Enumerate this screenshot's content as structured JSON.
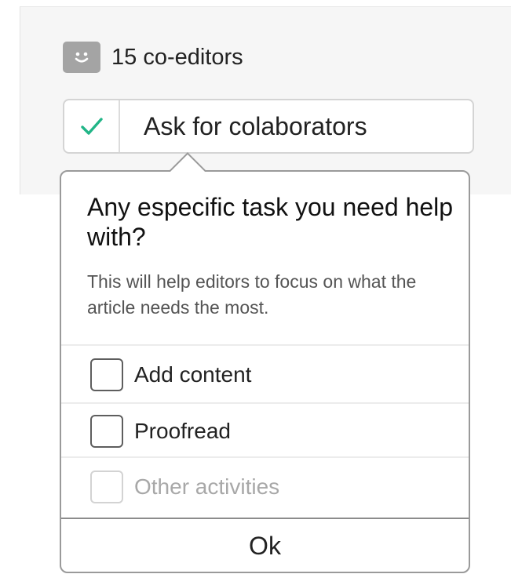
{
  "header": {
    "coeditors_label": "15 co-editors",
    "icon": "smiley-icon",
    "icon_color": "#a4a4a4"
  },
  "ask_button": {
    "label": "Ask for colaborators",
    "checked": true,
    "check_color": "#21b587"
  },
  "popup": {
    "title": "Any especific task you need help with?",
    "description": "This will help editors to focus on what the article needs the most.",
    "options": [
      {
        "label": "Add content",
        "checked": false,
        "disabled": false
      },
      {
        "label": "Proofread",
        "checked": false,
        "disabled": false
      },
      {
        "label": "Other activities",
        "checked": false,
        "disabled": true
      }
    ],
    "ok_label": "Ok"
  }
}
